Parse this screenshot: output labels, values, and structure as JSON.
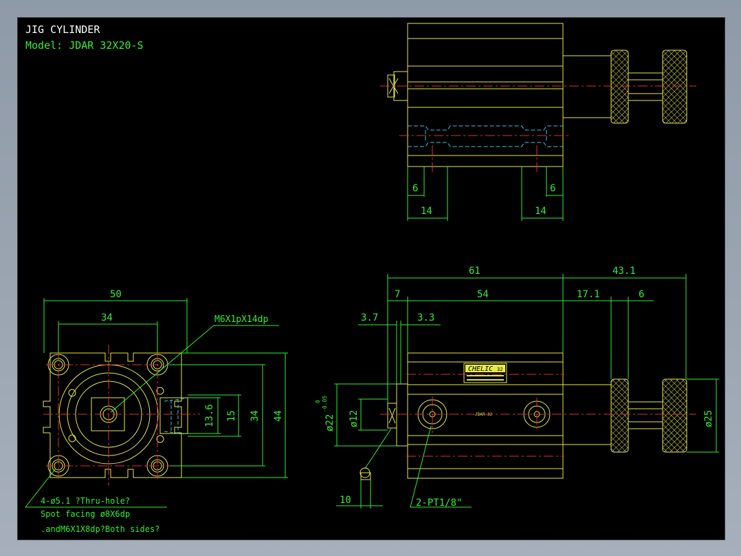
{
  "title_block": {
    "title": "JIG CYLINDER",
    "model": "Model: JDAR 32X20-S"
  },
  "brand": {
    "logo_text": "CHELIC",
    "logo_suffix": "32",
    "body_label": "JDAR 32"
  },
  "colors": {
    "background": "#000000",
    "outline": "#e8e84a",
    "dimension": "#33ee33",
    "centerline": "#e03030",
    "hidden": "#33c8e8",
    "title": "#ffffff"
  },
  "top_view": {
    "dims": {
      "left_small": "6",
      "left_large": "14",
      "right_small": "6",
      "right_large": "14"
    }
  },
  "side_view": {
    "dims": {
      "overall": "61",
      "extension": "43.1",
      "d7": "7",
      "d54": "54",
      "d17_1": "17.1",
      "d6": "6",
      "d3_7": "3.7",
      "d3_3": "3.3",
      "dia22": "ø22",
      "tol_upper": "0",
      "tol_lower": "-0.05",
      "dia12": "ø12",
      "dia25": "ø25",
      "d10": "10"
    },
    "port_note": "2-PT1/8\""
  },
  "end_view": {
    "dims": {
      "width": "50",
      "pitch": "34",
      "d13_6": "13.6",
      "d15": "15",
      "d34": "34",
      "d44": "44"
    },
    "thread_note": "M6X1pX14dp",
    "hole_note_1": "4-ø5.1 ?Thru-hole?",
    "hole_note_2": "Spot facing ø8X6dp",
    "hole_note_3": ".andM6X1X8dp?Both sides?"
  }
}
